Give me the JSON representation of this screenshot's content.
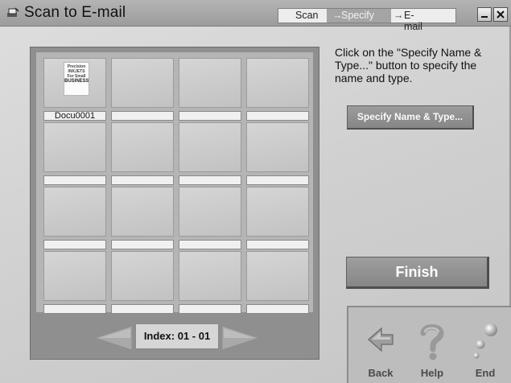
{
  "window": {
    "title": "Scan to E-mail",
    "minimize_label": "_",
    "close_label": "✕"
  },
  "steps": {
    "scan": "Scan",
    "specify": "Specify",
    "email": "E-mail",
    "arrow": "→",
    "active": "Specify"
  },
  "thumbnails": {
    "rows": 4,
    "columns": 4,
    "items": [
      {
        "label": "Docu0001",
        "has_preview": true
      },
      {
        "label": ""
      },
      {
        "label": ""
      },
      {
        "label": ""
      },
      {
        "label": ""
      },
      {
        "label": ""
      },
      {
        "label": ""
      },
      {
        "label": ""
      },
      {
        "label": ""
      },
      {
        "label": ""
      },
      {
        "label": ""
      },
      {
        "label": ""
      },
      {
        "label": ""
      },
      {
        "label": ""
      },
      {
        "label": ""
      },
      {
        "label": ""
      }
    ],
    "preview_lines": [
      "Precision",
      "INKJETS",
      "For Small",
      "BUSINESS"
    ]
  },
  "index": {
    "label": "Index: 01 - 01"
  },
  "instructions": "Click on the \"Specify Name & Type...\" button to specify the name and type.",
  "buttons": {
    "specify": "Specify Name & Type...",
    "finish": "Finish",
    "back": "Back",
    "help": "Help",
    "end": "End"
  },
  "icons": {
    "app": "scanner-icon",
    "back": "back-arrow-icon",
    "help": "question-mark-icon",
    "end": "end-bubbles-icon"
  },
  "colors": {
    "active_step_bg": "#a4a4a4",
    "button_bg": "#8f8f8f"
  }
}
